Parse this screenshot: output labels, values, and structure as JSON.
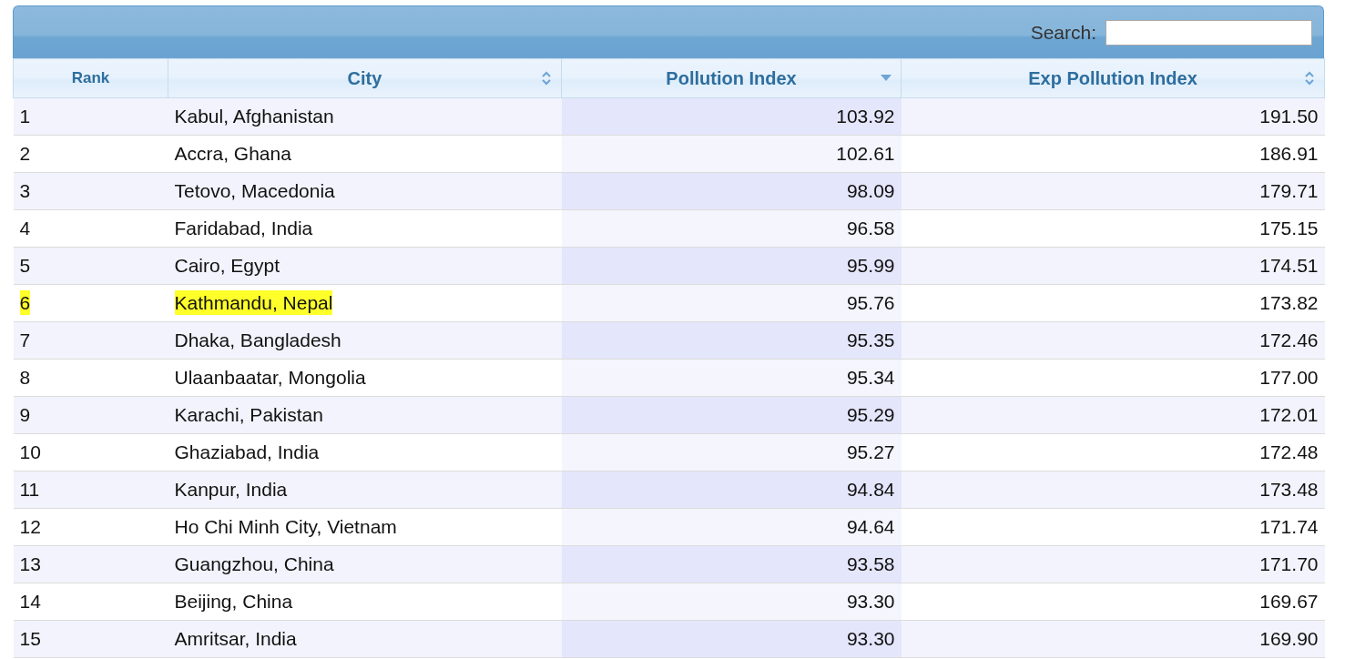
{
  "search": {
    "label": "Search:"
  },
  "columns": [
    {
      "label": "Rank",
      "sortable": false,
      "sorted": false
    },
    {
      "label": "City",
      "sortable": true,
      "sorted": false
    },
    {
      "label": "Pollution Index",
      "sortable": true,
      "sorted": true
    },
    {
      "label": "Exp Pollution Index",
      "sortable": true,
      "sorted": false
    }
  ],
  "rows": [
    {
      "cells": [
        "1",
        "Kabul, Afghanistan",
        "103.92",
        "191.50"
      ],
      "highlighted": false
    },
    {
      "cells": [
        "2",
        "Accra, Ghana",
        "102.61",
        "186.91"
      ],
      "highlighted": false
    },
    {
      "cells": [
        "3",
        "Tetovo, Macedonia",
        "98.09",
        "179.71"
      ],
      "highlighted": false
    },
    {
      "cells": [
        "4",
        "Faridabad, India",
        "96.58",
        "175.15"
      ],
      "highlighted": false
    },
    {
      "cells": [
        "5",
        "Cairo, Egypt",
        "95.99",
        "174.51"
      ],
      "highlighted": false
    },
    {
      "cells": [
        "6",
        "Kathmandu, Nepal",
        "95.76",
        "173.82"
      ],
      "highlighted": true
    },
    {
      "cells": [
        "7",
        "Dhaka, Bangladesh",
        "95.35",
        "172.46"
      ],
      "highlighted": false
    },
    {
      "cells": [
        "8",
        "Ulaanbaatar, Mongolia",
        "95.34",
        "177.00"
      ],
      "highlighted": false
    },
    {
      "cells": [
        "9",
        "Karachi, Pakistan",
        "95.29",
        "172.01"
      ],
      "highlighted": false
    },
    {
      "cells": [
        "10",
        "Ghaziabad, India",
        "95.27",
        "172.48"
      ],
      "highlighted": false
    },
    {
      "cells": [
        "11",
        "Kanpur, India",
        "94.84",
        "173.48"
      ],
      "highlighted": false
    },
    {
      "cells": [
        "12",
        "Ho Chi Minh City, Vietnam",
        "94.64",
        "171.74"
      ],
      "highlighted": false
    },
    {
      "cells": [
        "13",
        "Guangzhou, China",
        "93.58",
        "171.70"
      ],
      "highlighted": false
    },
    {
      "cells": [
        "14",
        "Beijing, China",
        "93.30",
        "169.67"
      ],
      "highlighted": false
    },
    {
      "cells": [
        "15",
        "Amritsar, India",
        "93.30",
        "169.90"
      ],
      "highlighted": false
    }
  ]
}
